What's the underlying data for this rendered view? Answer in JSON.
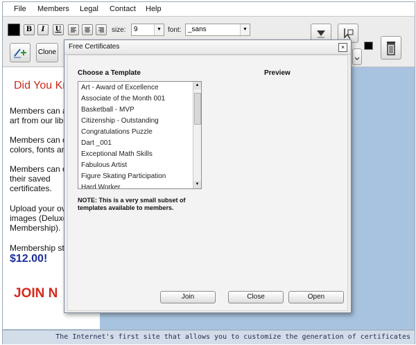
{
  "menu": [
    "File",
    "Members",
    "Legal",
    "Contact",
    "Help"
  ],
  "toolbar": {
    "bold": "B",
    "italic": "I",
    "underline": "U",
    "size_label": "size:",
    "size_value": "9",
    "font_label": "font:",
    "font_value": "_sans",
    "clone_label": "Clone"
  },
  "page": {
    "heading": "Did You Kn",
    "p1": [
      "Members can a",
      "art from our lib"
    ],
    "p2": [
      "Members can c",
      "colors, fonts ar"
    ],
    "p3": [
      "Members can o",
      "their saved",
      "certificates."
    ],
    "p4": [
      "Upload your ov",
      "images (Deluxe",
      "Membership)."
    ],
    "p5": "Membership sta",
    "price": "$12.00!",
    "join": "JOIN N"
  },
  "dialog": {
    "title": "Free Certificates",
    "choose_label": "Choose a Template",
    "preview_label": "Preview",
    "templates": [
      "Art - Award of Excellence",
      "Associate of the Month 001",
      "Basketball - MVP",
      "Citizenship - Outstanding",
      "Congratulations Puzzle",
      "Dart _001",
      "Exceptional Math Skills",
      "Fabulous Artist",
      "Figure Skating Participation",
      "Hard Worker"
    ],
    "note": "NOTE: This is a very small subset of templates available to members.",
    "join_button": "Join",
    "close_button": "Close",
    "open_button": "Open"
  },
  "status": "The Internet's first site that allows you to customize the generation of certificates",
  "colors": {
    "heading": "#cc2a1a",
    "price": "#1a2e9c",
    "join": "#d42a1e",
    "background": "#a8c3df"
  }
}
